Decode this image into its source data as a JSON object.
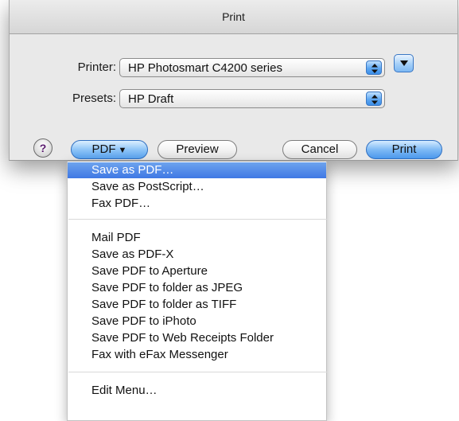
{
  "dialog": {
    "title": "Print",
    "printer_label": "Printer:",
    "printer_value": "HP Photosmart C4200 series",
    "presets_label": "Presets:",
    "presets_value": "HP Draft",
    "help_label": "?",
    "pdf_label": "PDF",
    "pdf_arrow": "▼",
    "preview_label": "Preview",
    "cancel_label": "Cancel",
    "print_label": "Print"
  },
  "pdf_menu": {
    "items": [
      "Save as PDF…",
      "Save as PostScript…",
      "Fax PDF…",
      "Mail PDF",
      "Save as PDF-X",
      "Save PDF to Aperture",
      "Save PDF to folder as JPEG",
      "Save PDF to folder as TIFF",
      "Save PDF to iPhoto",
      "Save PDF to Web Receipts Folder",
      "Fax with eFax Messenger",
      "Edit Menu…"
    ],
    "selected": "Save as PDF…"
  },
  "colors": {
    "accent": "#3f78e4",
    "sheet_bg": "#e9e9e9",
    "aqua_blue": "#5aa3ef"
  }
}
